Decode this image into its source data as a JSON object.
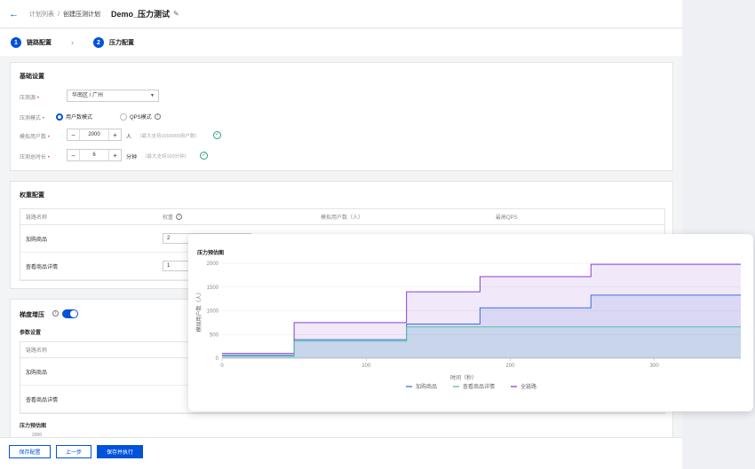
{
  "header": {
    "breadcrumb_1": "计划列表",
    "breadcrumb_sep": "/",
    "breadcrumb_2": "创建压测计划",
    "title": "Demo_压力测试"
  },
  "steps": [
    {
      "num": "1",
      "label": "链路配置"
    },
    {
      "num": "2",
      "label": "压力配置"
    }
  ],
  "basic": {
    "title": "基础设置",
    "source_label": "压测源",
    "source_value": "华南区 / 广州",
    "mode_label": "压测模式",
    "mode_user": "用户数模式",
    "mode_qps": "QPS模式",
    "users_label": "模拟用户数",
    "users_value": "2000",
    "users_unit": "人",
    "users_hint": "（最大支持1000000用户数）",
    "duration_label": "压测总时长",
    "duration_value": "6",
    "duration_unit": "分钟",
    "duration_hint": "（最大支持100分钟）"
  },
  "weights": {
    "title": "权重配置",
    "columns": [
      "链路名称",
      "权重",
      "模拟用户数（人）",
      "最高QPS"
    ],
    "rows": [
      {
        "name": "加购商品",
        "weight": "2"
      },
      {
        "name": "查看商品详情",
        "weight": "1"
      }
    ]
  },
  "ramp": {
    "title": "梯度增压",
    "params_label": "参数设置",
    "column": "链路名称",
    "rows": [
      "加购商品",
      "查看商品详情"
    ],
    "chart_label": "压力预估图",
    "chart_tick": "2000"
  },
  "footer": {
    "save": "保存配置",
    "prev": "上一步",
    "save_run": "保存并执行"
  },
  "colors": {
    "primary": "#0052d9",
    "series_blue": "#3b6fe0",
    "series_green": "#4fc3a6",
    "series_purple": "#8a3fd1"
  },
  "chart_data": {
    "type": "line",
    "title": "压力预估图",
    "xlabel": "时间（秒）",
    "ylabel": "模拟用户数（人）",
    "xlim": [
      0,
      360
    ],
    "ylim": [
      0,
      2000
    ],
    "xticks": [
      "0",
      "100",
      "200",
      "300"
    ],
    "yticks": [
      "0",
      "500",
      "1000",
      "1500",
      "2000"
    ],
    "legend_position": "bottom",
    "grid": true,
    "step": true,
    "series": [
      {
        "name": "加购商品",
        "color": "#3b6fe0",
        "points": [
          [
            0,
            60
          ],
          [
            50,
            60
          ],
          [
            50,
            390
          ],
          [
            128,
            390
          ],
          [
            128,
            720
          ],
          [
            179,
            720
          ],
          [
            179,
            1060
          ],
          [
            256,
            1060
          ],
          [
            256,
            1330
          ],
          [
            360,
            1330
          ]
        ]
      },
      {
        "name": "查看商品详情",
        "color": "#4fc3a6",
        "points": [
          [
            0,
            40
          ],
          [
            50,
            40
          ],
          [
            50,
            360
          ],
          [
            128,
            360
          ],
          [
            128,
            660
          ],
          [
            360,
            660
          ]
        ]
      },
      {
        "name": "全链路",
        "color": "#8a3fd1",
        "points": [
          [
            0,
            100
          ],
          [
            50,
            100
          ],
          [
            50,
            750
          ],
          [
            128,
            750
          ],
          [
            128,
            1400
          ],
          [
            179,
            1400
          ],
          [
            179,
            1720
          ],
          [
            256,
            1720
          ],
          [
            256,
            1980
          ],
          [
            360,
            1980
          ]
        ]
      }
    ]
  }
}
